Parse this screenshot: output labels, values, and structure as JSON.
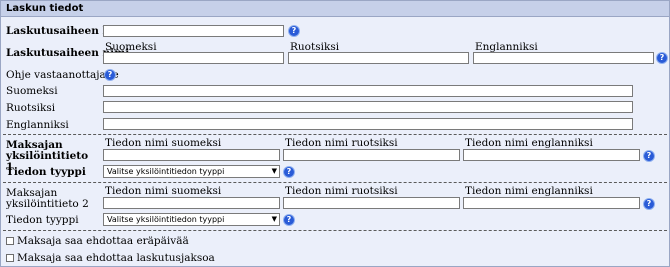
{
  "header": {
    "title": "Laskun tiedot"
  },
  "fields": {
    "code_label": "Laskutusaiheen koodi",
    "name_label": "Laskutusaiheen nimi",
    "lang_finnish": "Suomeksi",
    "lang_swedish": "Ruotsiksi",
    "lang_english": "Englanniksi",
    "guide_label": "Ohje vastaanottajalle",
    "guide_fi": "Suomeksi",
    "guide_sv": "Ruotsiksi",
    "guide_en": "Englanniksi"
  },
  "identifier1": {
    "label": "Maksajan yksilöintitieto 1",
    "col_fi": "Tiedon nimi suomeksi",
    "col_sv": "Tiedon nimi ruotsiksi",
    "col_en": "Tiedon nimi englanniksi",
    "type_label": "Tiedon tyyppi",
    "type_value": "Valitse yksilöintitiedon tyyppi"
  },
  "identifier2": {
    "label": "Maksajan yksilöintitieto 2",
    "col_fi": "Tiedon nimi suomeksi",
    "col_sv": "Tiedon nimi ruotsiksi",
    "col_en": "Tiedon nimi englanniksi",
    "type_label": "Tiedon tyyppi",
    "type_value": "Valitse yksilöintitiedon tyyppi"
  },
  "options": {
    "due_date": "Maksaja saa ehdottaa eräpäivää",
    "billing_period": "Maksaja saa ehdottaa laskutusjaksoa"
  },
  "icons": {
    "help": "help-icon",
    "dropdown": "chevron-down-icon"
  }
}
